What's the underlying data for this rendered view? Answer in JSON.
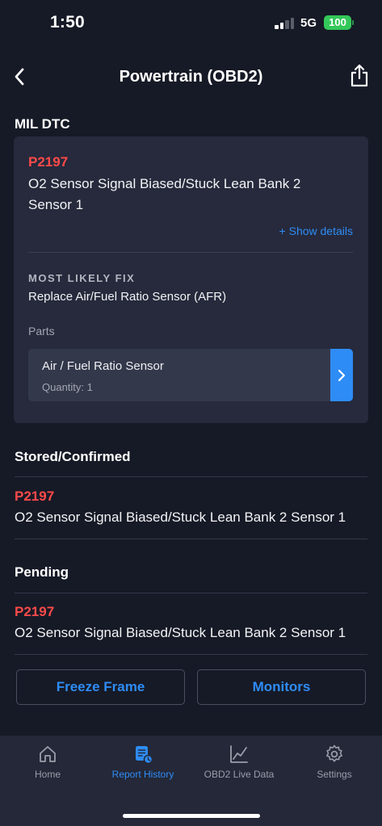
{
  "status_bar": {
    "time": "1:50",
    "network": "5G",
    "battery": "100"
  },
  "nav": {
    "title": "Powertrain (OBD2)",
    "back_icon": "chevron-left-icon",
    "share_icon": "share-icon"
  },
  "mil": {
    "heading": "MIL DTC",
    "code": "P2197",
    "description": "O2 Sensor Signal Biased/Stuck Lean Bank 2 Sensor 1",
    "show_details": "+ Show details",
    "fix_heading": "MOST LIKELY FIX",
    "fix_text": "Replace Air/Fuel Ratio Sensor (AFR)",
    "parts_label": "Parts",
    "part": {
      "name": "Air / Fuel Ratio Sensor",
      "quantity": "Quantity: 1"
    }
  },
  "stored": {
    "heading": "Stored/Confirmed",
    "code": "P2197",
    "description": "O2 Sensor Signal Biased/Stuck Lean Bank 2 Sensor 1"
  },
  "pending": {
    "heading": "Pending",
    "code": "P2197",
    "description": "O2 Sensor Signal Biased/Stuck Lean Bank 2 Sensor 1"
  },
  "buttons": {
    "freeze_frame": "Freeze Frame",
    "monitors": "Monitors"
  },
  "tabs": [
    {
      "label": "Home",
      "icon": "home-icon",
      "active": false
    },
    {
      "label": "Report History",
      "icon": "report-history-icon",
      "active": true
    },
    {
      "label": "OBD2 Live Data",
      "icon": "line-chart-icon",
      "active": false
    },
    {
      "label": "Settings",
      "icon": "gear-icon",
      "active": false
    }
  ],
  "colors": {
    "accent": "#2e8cf6",
    "dtc_red": "#ff4a4a",
    "background": "#161a26",
    "card": "#262a3c",
    "battery": "#34c759"
  }
}
